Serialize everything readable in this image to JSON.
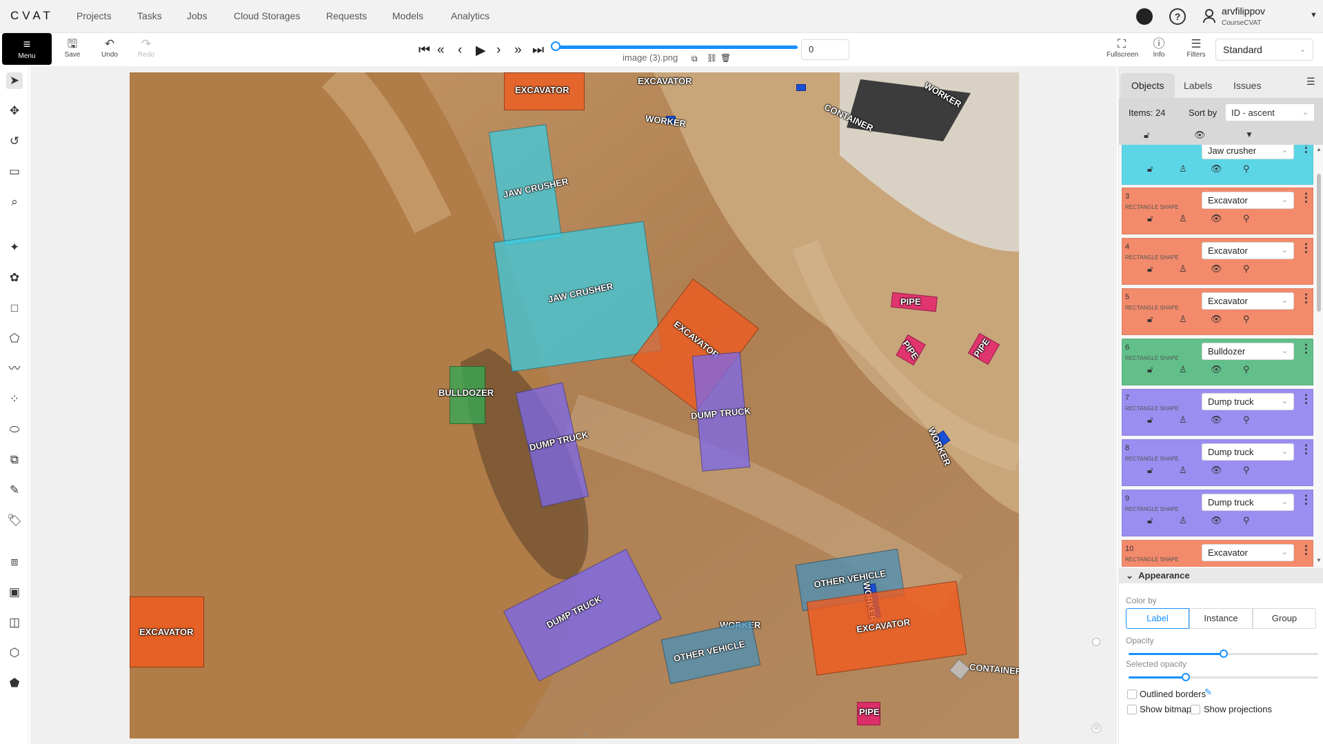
{
  "app": {
    "logo": "CVAT"
  },
  "nav": {
    "items": [
      "Projects",
      "Tasks",
      "Jobs",
      "Cloud Storages",
      "Requests",
      "Models",
      "Analytics"
    ]
  },
  "user": {
    "name": "arvfilippov",
    "org": "CourseCVAT"
  },
  "toolbar": {
    "menu_label": "Menu",
    "save_label": "Save",
    "undo_label": "Undo",
    "redo_label": "Redo",
    "frame_value": "0",
    "filename": "image (3).png",
    "fullscreen_label": "Fullscreen",
    "info_label": "Info",
    "filters_label": "Filters",
    "workspace": "Standard"
  },
  "colors": {
    "excavator": "#f25a1d",
    "jaw_crusher": "#3ccbe0",
    "bulldozer": "#34a853",
    "dump_truck": "#7b68ee",
    "other_vehicle": "#4a90b8",
    "worker": "#1a4fd6",
    "pipe": "#e6196b",
    "container": "#c2c2c2",
    "list_jaw": "#5cd6e6",
    "list_exc": "#f28a6b",
    "list_bull": "#62bf8a",
    "list_dump": "#9a8ef0"
  },
  "canvas_labels": [
    {
      "text": "EXCAVATOR"
    },
    {
      "text": "EXCAVATOR"
    },
    {
      "text": "WORKER"
    },
    {
      "text": "WORKER"
    },
    {
      "text": "CONTAINER"
    },
    {
      "text": "JAW CRUSHER"
    },
    {
      "text": "JAW CRUSHER"
    },
    {
      "text": "PIPE"
    },
    {
      "text": "PIPE"
    },
    {
      "text": "PIPE"
    },
    {
      "text": "EXCAVATOR"
    },
    {
      "text": "BULLDOZER"
    },
    {
      "text": "DUMP TRUCK"
    },
    {
      "text": "DUMP TRUCK"
    },
    {
      "text": "WORKER"
    },
    {
      "text": "EXCAVATOR"
    },
    {
      "text": "OTHER VEHICLE"
    },
    {
      "text": "WORKER"
    },
    {
      "text": "DUMP TRUCK"
    },
    {
      "text": "WORKER"
    },
    {
      "text": "OTHER VEHICLE"
    },
    {
      "text": "EXCAVATOR"
    },
    {
      "text": "CONTAINER"
    },
    {
      "text": "PIPE"
    }
  ],
  "sidebar": {
    "tabs": [
      "Objects",
      "Labels",
      "Issues"
    ],
    "items_count": "Items: 24",
    "sort_label": "Sort by",
    "sort_value": "ID - ascent",
    "objects": [
      {
        "id": "2",
        "type": "RECTANGLE SHAPE",
        "label": "Jaw crusher"
      },
      {
        "id": "3",
        "type": "RECTANGLE SHAPE",
        "label": "Excavator"
      },
      {
        "id": "4",
        "type": "RECTANGLE SHAPE",
        "label": "Excavator"
      },
      {
        "id": "5",
        "type": "RECTANGLE SHAPE",
        "label": "Excavator"
      },
      {
        "id": "6",
        "type": "RECTANGLE SHAPE",
        "label": "Bulldozer"
      },
      {
        "id": "7",
        "type": "RECTANGLE SHAPE",
        "label": "Dump truck"
      },
      {
        "id": "8",
        "type": "RECTANGLE SHAPE",
        "label": "Dump truck"
      },
      {
        "id": "9",
        "type": "RECTANGLE SHAPE",
        "label": "Dump truck"
      },
      {
        "id": "10",
        "type": "RECTANGLE SHAPE",
        "label": "Excavator"
      }
    ]
  },
  "appearance": {
    "title": "Appearance",
    "color_by_label": "Color by",
    "color_by_options": [
      "Label",
      "Instance",
      "Group"
    ],
    "color_by_selected": "Label",
    "opacity_label": "Opacity",
    "opacity": 0.5,
    "selected_opacity_label": "Selected opacity",
    "selected_opacity": 0.3,
    "outlined_borders": "Outlined borders",
    "show_bitmap": "Show bitmap",
    "show_projections": "Show projections"
  }
}
